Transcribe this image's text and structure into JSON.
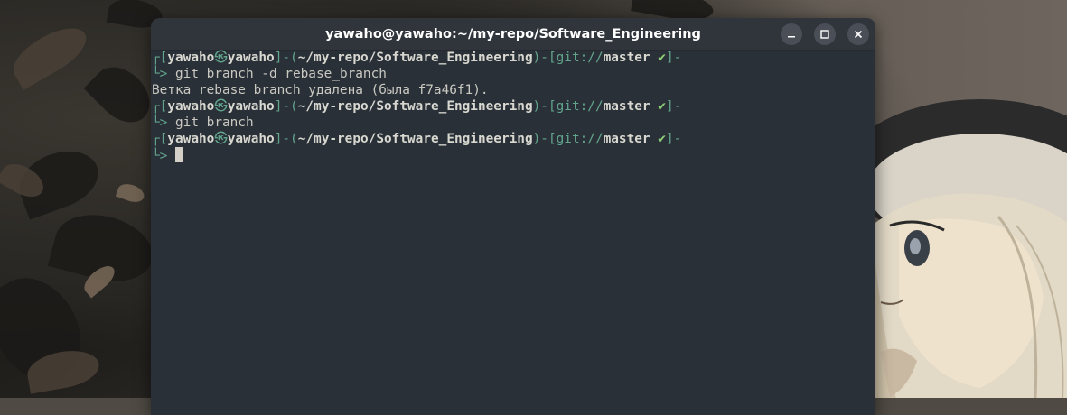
{
  "window": {
    "title": "yawaho@yawaho:~/my-repo/Software_Engineering"
  },
  "prompt": {
    "user": "yawaho",
    "at_symbol": "㉿",
    "host": "yawaho",
    "path": "~/my-repo/Software_Engineering",
    "git_label": "git://",
    "branch": "master",
    "check": "✔"
  },
  "terminal": {
    "blocks": [
      {
        "command": "git branch -d rebase_branch",
        "output": "Ветка rebase_branch удалена (была f7a46f1)."
      },
      {
        "command": "git branch",
        "output": ""
      },
      {
        "command": "",
        "output": ""
      }
    ]
  },
  "colors": {
    "terminal_bg": "#2a3038",
    "titlebar_bg": "#30353c",
    "prompt_accent": "#62a58c",
    "check_green": "#8fcf78"
  },
  "icons": {
    "minimize": "minimize-icon",
    "maximize": "maximize-icon",
    "close": "close-icon"
  }
}
